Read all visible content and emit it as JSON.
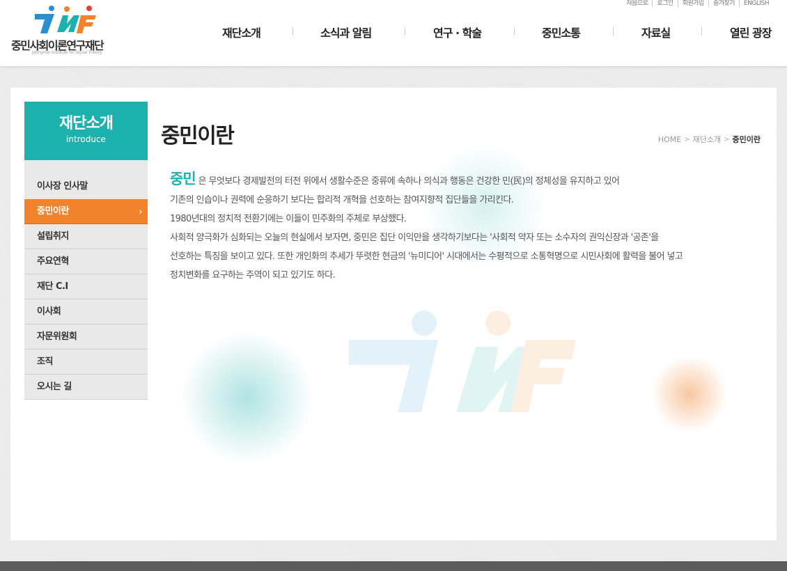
{
  "logo": {
    "mark_text": "JMF",
    "name": "중민사회이론연구재단",
    "subtitle": "Joongmin Institute for Social Theory",
    "colors": {
      "teal": "#1cb1ad",
      "orange": "#f0832c",
      "red": "#e0433a",
      "blue": "#2a8fd0"
    }
  },
  "util_nav": [
    "처음으로",
    "로그인",
    "회원가입",
    "즐겨찾기",
    "ENGLISH"
  ],
  "gnb": [
    "재단소개",
    "소식과 알림",
    "연구 · 학술",
    "중민소통",
    "자료실",
    "열린 광장"
  ],
  "lnb": {
    "title": "재단소개",
    "subtitle": "introduce",
    "items": [
      "이사장 인사말",
      "중민이란",
      "설립취지",
      "주요연혁",
      "재단 C.I",
      "이사회",
      "자문위원회",
      "조직",
      "오시는 길"
    ],
    "active_index": 1,
    "active_arrow": "›"
  },
  "page": {
    "title": "중민이란",
    "breadcrumb": [
      "HOME",
      "재단소개",
      "중민이란"
    ]
  },
  "content": {
    "lead": "중민",
    "lines": [
      "은 무엇보다 경제발전의 터전 위에서 생활수준은 중류에 속하나 의식과 행동은 건강한 민(民)의 정체성을 유지하고 있어",
      "기존의 인습이나 권력에 순응하기 보다는 합리적 개혁을 선호하는 참여지향적 집단들을 가리킨다.",
      "1980년대의 정치적 전환기에는 이들이 민주화의 주체로 부상했다.",
      "사회적 양극화가 심화되는 오늘의 현실에서 보자면, 중민은 집단 이익만을 생각하기보다는 '사회적 약자 또는 소수자의 권익신장과 '공존'을",
      "선호하는 특징을 보이고 있다. 또한 개인화의 추세가 뚜렷한 현금의 '뉴미디어' 시대에서는 수평적으로 소통혁명으로 시민사회에 활력을 불어 넣고",
      "정치변화를 요구하는 주역이 되고 있기도 하다."
    ]
  },
  "theme": {
    "teal": "#1cb1ad",
    "orange": "#f0832c",
    "footer": "#5c5c5c"
  }
}
